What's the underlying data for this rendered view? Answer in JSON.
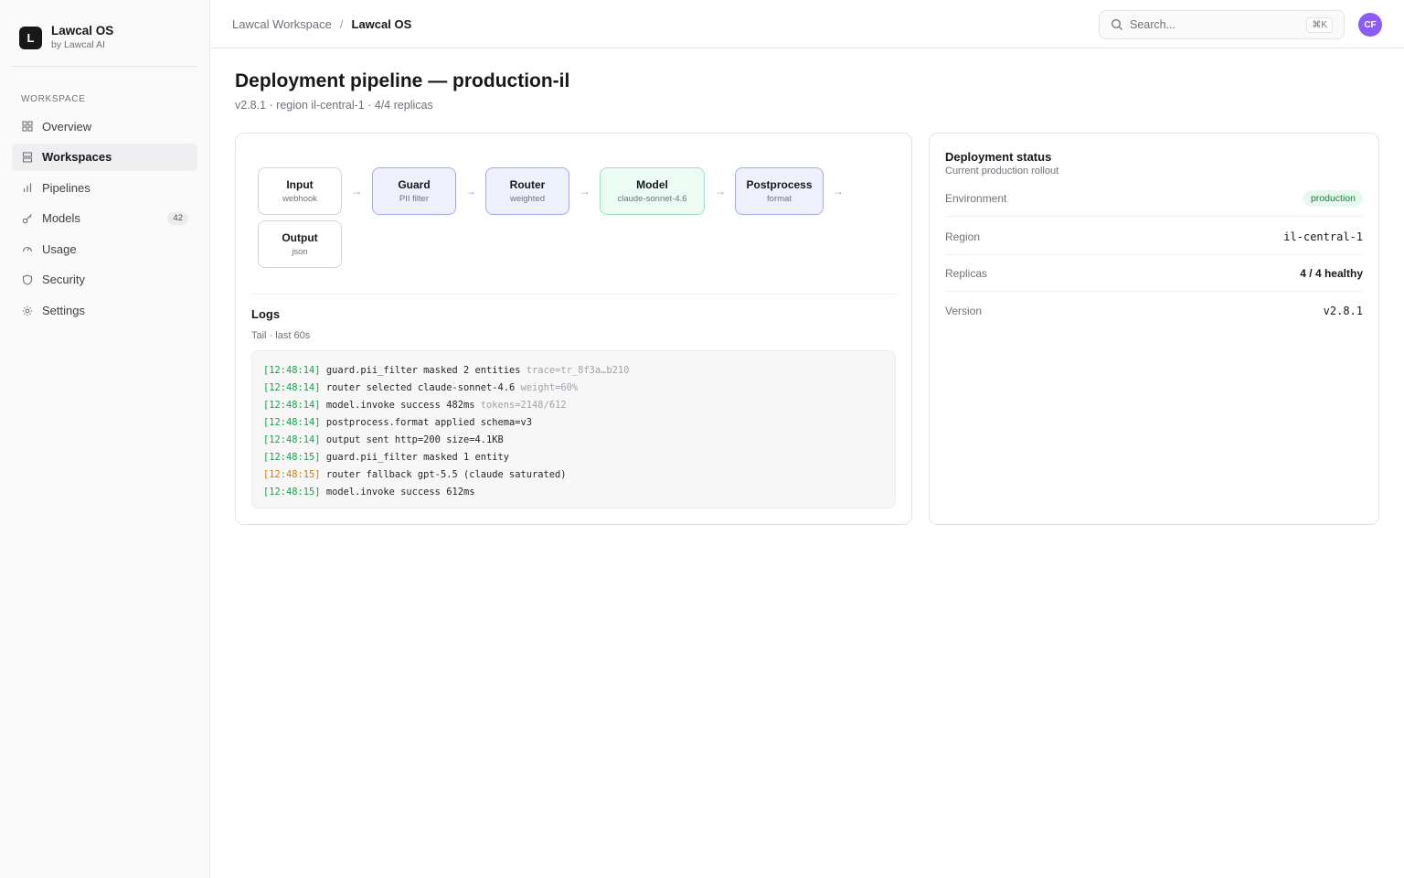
{
  "brand": {
    "logo_letter": "L",
    "name": "Lawcal OS",
    "sub": "by Lawcal AI"
  },
  "sidebar": {
    "section_label": "WORKSPACE",
    "items": [
      {
        "label": "Overview",
        "icon": "grid-icon"
      },
      {
        "label": "Workspaces",
        "icon": "stack-icon",
        "active": true
      },
      {
        "label": "Pipelines",
        "icon": "bar-chart-icon"
      },
      {
        "label": "Models",
        "icon": "key-icon",
        "badge": "42"
      },
      {
        "label": "Usage",
        "icon": "gauge-icon"
      },
      {
        "label": "Security",
        "icon": "shield-icon"
      },
      {
        "label": "Settings",
        "icon": "gear-icon"
      }
    ]
  },
  "header": {
    "breadcrumb": [
      "Lawcal Workspace",
      "Lawcal OS"
    ],
    "breadcrumb_sep": "/",
    "search_placeholder": "Search...",
    "search_shortcut": "⌘K",
    "avatar_initials": "CF"
  },
  "page": {
    "title": "Deployment pipeline — production-il",
    "subtitle": "v2.8.1 · region il-central-1 · 4/4 replicas"
  },
  "pipeline": {
    "nodes": [
      {
        "title": "Input",
        "sub": "webhook",
        "style": "plain"
      },
      {
        "title": "Guard",
        "sub": "PII filter",
        "style": "purple"
      },
      {
        "title": "Router",
        "sub": "weighted",
        "style": "purple"
      },
      {
        "title": "Model",
        "sub": "claude-sonnet-4.6",
        "style": "green"
      },
      {
        "title": "Postprocess",
        "sub": "format",
        "style": "purple"
      },
      {
        "title": "Output",
        "sub": "json",
        "style": "plain"
      }
    ],
    "arrow": "→"
  },
  "logs": {
    "title": "Logs",
    "subtitle": "Tail · last 60s",
    "lines": [
      {
        "ts": "[12:48:14]",
        "msg": "guard.pii_filter masked 2 entities",
        "meta": "trace=tr_8f3a…b210",
        "level": "info"
      },
      {
        "ts": "[12:48:14]",
        "msg": "router selected claude-sonnet-4.6",
        "meta": "weight=60%",
        "level": "info"
      },
      {
        "ts": "[12:48:14]",
        "msg": "model.invoke success 482ms",
        "meta": "tokens=2148/612",
        "level": "info"
      },
      {
        "ts": "[12:48:14]",
        "msg": "postprocess.format applied schema=v3",
        "meta": "",
        "level": "info"
      },
      {
        "ts": "[12:48:14]",
        "msg": "output sent http=200 size=4.1KB",
        "meta": "",
        "level": "info"
      },
      {
        "ts": "[12:48:15]",
        "msg": "guard.pii_filter masked 1 entity",
        "meta": "",
        "level": "info"
      },
      {
        "ts": "[12:48:15]",
        "msg": "router fallback gpt-5.5 (claude saturated)",
        "meta": "",
        "level": "warn"
      },
      {
        "ts": "[12:48:15]",
        "msg": "model.invoke success 612ms",
        "meta": "",
        "level": "info"
      }
    ]
  },
  "status": {
    "title": "Deployment status",
    "subtitle": "Current production rollout",
    "rows": [
      {
        "label": "Environment",
        "value": "production",
        "kind": "pill"
      },
      {
        "label": "Region",
        "value": "il-central-1",
        "kind": "mono"
      },
      {
        "label": "Replicas",
        "value": "4 / 4 healthy",
        "kind": "bold"
      },
      {
        "label": "Version",
        "value": "v2.8.1",
        "kind": "mono"
      }
    ]
  },
  "colors": {
    "accent_purple": "#8b5cf6",
    "node_purple_bg": "#eef0fd",
    "node_green_bg": "#ecfbf4",
    "log_ts_green": "#16a34a",
    "log_ts_warn": "#d97706",
    "pill_green": "#15803d"
  }
}
